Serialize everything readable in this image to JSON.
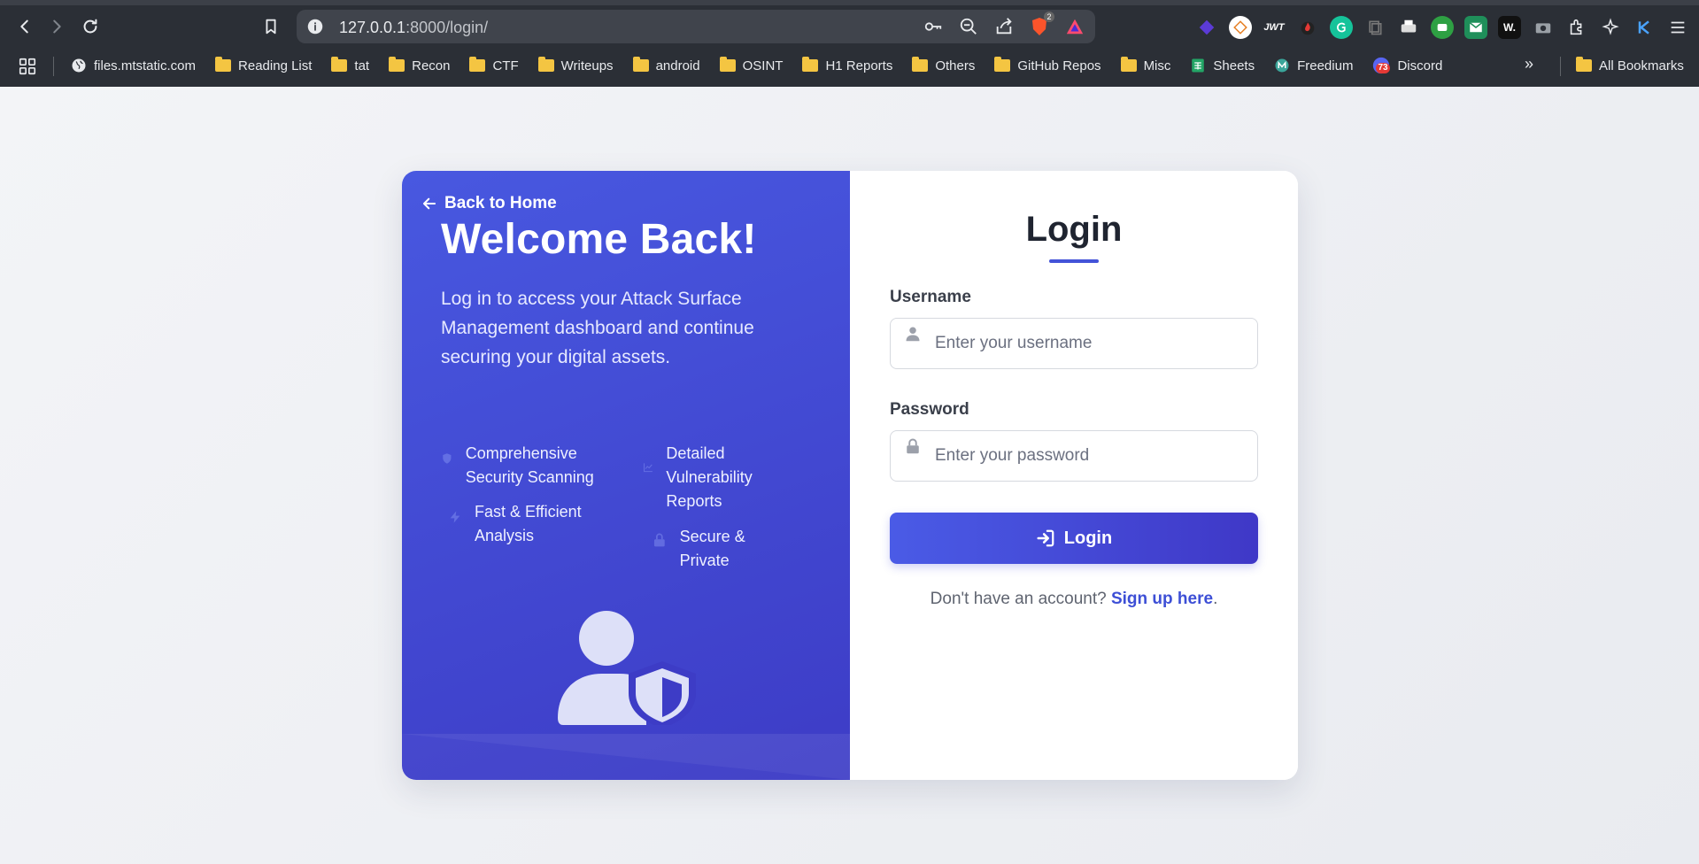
{
  "browser": {
    "url_host": "127.0.0.1",
    "url_path": ":8000/login/",
    "brave_badge": "2",
    "discord_badge": "73",
    "bookmarks": [
      {
        "label": "files.mtstatic.com",
        "icon": "globe-icon"
      },
      {
        "label": "Reading List",
        "icon": "folder-icon"
      },
      {
        "label": "tat",
        "icon": "folder-icon"
      },
      {
        "label": "Recon",
        "icon": "folder-icon"
      },
      {
        "label": "CTF",
        "icon": "folder-icon"
      },
      {
        "label": "Writeups",
        "icon": "folder-icon"
      },
      {
        "label": "android",
        "icon": "folder-icon"
      },
      {
        "label": "OSINT",
        "icon": "folder-icon"
      },
      {
        "label": "H1 Reports",
        "icon": "folder-icon"
      },
      {
        "label": "Others",
        "icon": "folder-icon"
      },
      {
        "label": "GitHub Repos",
        "icon": "folder-icon"
      },
      {
        "label": "Misc",
        "icon": "folder-icon"
      },
      {
        "label": "Sheets",
        "icon": "sheets-icon"
      },
      {
        "label": "Freedium",
        "icon": "freedium-icon"
      },
      {
        "label": "Discord",
        "icon": "discord-icon"
      }
    ],
    "more_label": "»",
    "all_bookmarks": "All Bookmarks",
    "extension_texts": {
      "wappalyzer": "W.",
      "jwt": "JWT"
    }
  },
  "left_panel": {
    "back_link": "Back to Home",
    "heading": "Welcome Back!",
    "intro": "Log in to access your Attack Surface Management dashboard and continue securing your digital assets.",
    "features": [
      {
        "label": "Comprehensive Security Scanning",
        "icon": "shield-icon"
      },
      {
        "label": "Detailed Vulnerability Reports",
        "icon": "chart-line-icon"
      },
      {
        "label": "Fast & Efficient Analysis",
        "icon": "bolt-icon"
      },
      {
        "label": "Secure & Private",
        "icon": "lock-icon"
      }
    ]
  },
  "form": {
    "title": "Login",
    "username_label": "Username",
    "username_placeholder": "Enter your username",
    "password_label": "Password",
    "password_placeholder": "Enter your password",
    "submit_label": "Login",
    "signup_prompt": "Don't have an account?",
    "signup_link": "Sign up here",
    "signup_suffix": "."
  },
  "colors": {
    "primary": "#4353d8",
    "primary_dark": "#3d3cc6",
    "chrome_bg": "#2b2f36",
    "page_bg": "#eef0f4"
  }
}
